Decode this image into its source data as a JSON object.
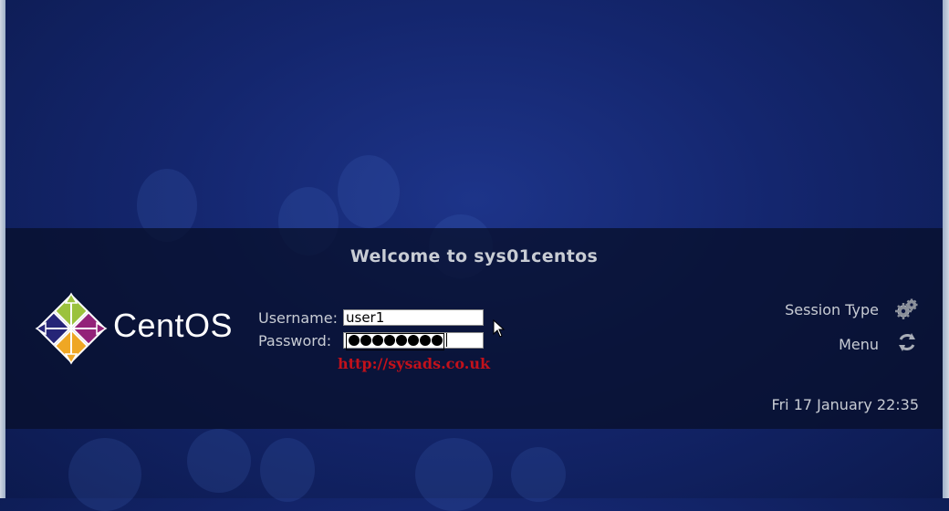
{
  "greeter": {
    "welcome": "Welcome to sys01centos",
    "logo_text": "CentOS",
    "username_label": "Username:",
    "username_value": "user1",
    "password_label": "Password:",
    "password_masked_count": 8,
    "watermark": "http://sysads.co.uk",
    "session_type_label": "Session Type",
    "menu_label": "Menu",
    "clock": "Fri 17 January 22:35"
  },
  "icons": {
    "session_type": "gears-icon",
    "menu": "refresh-icon",
    "logo": "centos-logo-icon",
    "pointer": "mouse-pointer-icon"
  },
  "colors": {
    "background": "#14266e",
    "panel": "#08102c",
    "text": "#c8ccd4",
    "watermark": "#c2111b"
  }
}
